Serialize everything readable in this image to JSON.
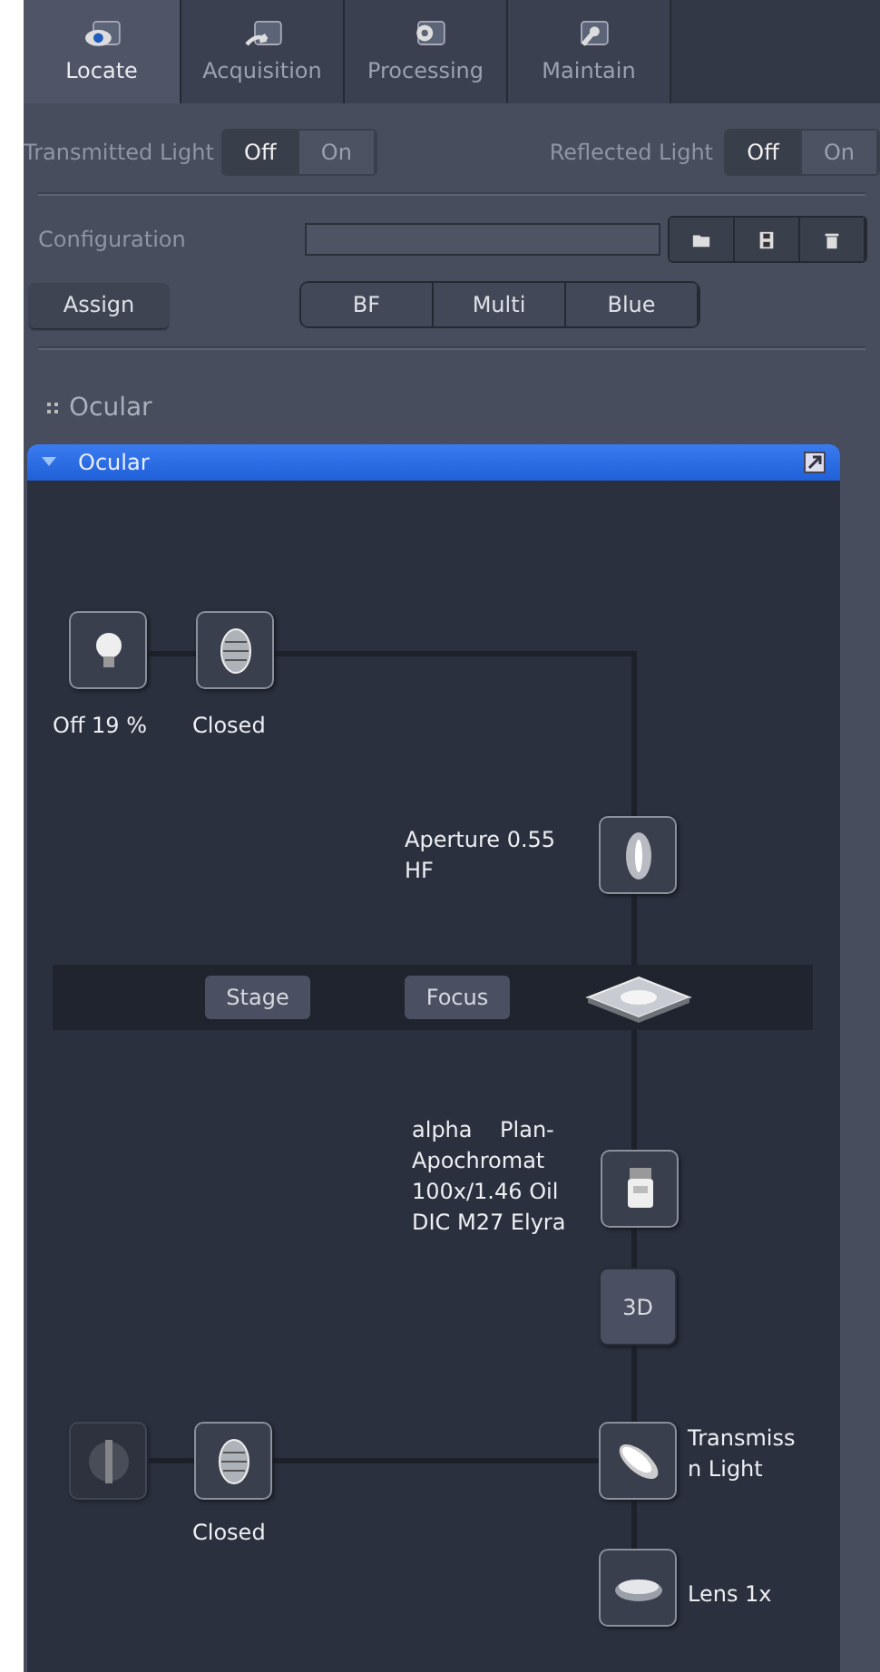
{
  "tabs": [
    {
      "label": "Locate",
      "selected": true
    },
    {
      "label": "Acquisition",
      "selected": false
    },
    {
      "label": "Processing",
      "selected": false
    },
    {
      "label": "Maintain",
      "selected": false
    }
  ],
  "lights": [
    {
      "label": "Transmitted Light",
      "options": [
        {
          "label": "Off",
          "selected": true
        },
        {
          "label": "On",
          "selected": false
        }
      ]
    },
    {
      "label": "Reflected Light",
      "options": [
        {
          "label": "Off",
          "selected": true
        },
        {
          "label": "On",
          "selected": false
        }
      ]
    }
  ],
  "configuration": {
    "label": "Configuration",
    "actions": [
      {
        "kind": "open"
      },
      {
        "kind": "save"
      },
      {
        "kind": "delete"
      }
    ]
  },
  "assign_button": "Assign",
  "presets": [
    {
      "label": "BF"
    },
    {
      "label": "Multi"
    },
    {
      "label": "Blue"
    }
  ],
  "section_title": "Ocular",
  "panel": {
    "title": "Ocular",
    "expanded": true
  },
  "diagram": {
    "nodes": [
      {
        "kind": "lamp",
        "disabled": false,
        "lines": [
          "Off 19 %"
        ]
      },
      {
        "kind": "shutter",
        "disabled": false,
        "lines": [
          "Closed"
        ]
      },
      {
        "kind": "aperture",
        "disabled": false,
        "lines": [
          "Aperture 0.55",
          "HF"
        ]
      },
      {
        "kind": "objective",
        "disabled": false,
        "lines": [
          "alpha    Plan-",
          "Apochromat",
          "100x/1.46 Oil",
          "DIC M27 Elyra"
        ]
      },
      {
        "kind": "text",
        "disabled": false,
        "text": "3D"
      },
      {
        "kind": "source",
        "disabled": true
      },
      {
        "kind": "shutter",
        "disabled": false,
        "lines": [
          "Closed"
        ]
      },
      {
        "kind": "reflector",
        "disabled": false,
        "lines": [
          "Transmiss",
          "n Light"
        ]
      },
      {
        "kind": "lens",
        "disabled": false,
        "lines": [
          "Lens 1x"
        ]
      }
    ],
    "stage_buttons": [
      "Stage",
      "Focus"
    ]
  }
}
